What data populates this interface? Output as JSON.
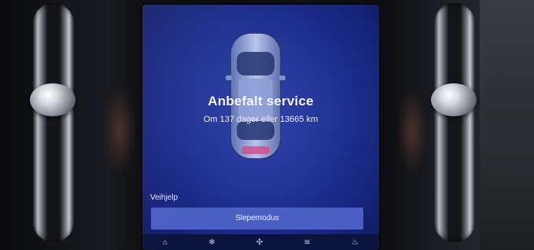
{
  "screen": {
    "title": "Anbefalt service",
    "subtitle": "Om 137 dager eller 13665 km",
    "section_label": "Veihjelp",
    "action_button_label": "Slepemodus",
    "colors": {
      "background": "#233596",
      "button": "#4a5fc4",
      "text": "#f4f6ff"
    }
  },
  "statusbar": {
    "icons": [
      "home-icon",
      "climate-icon",
      "fan-icon",
      "temperature-icon",
      "seat-heat-icon"
    ]
  }
}
